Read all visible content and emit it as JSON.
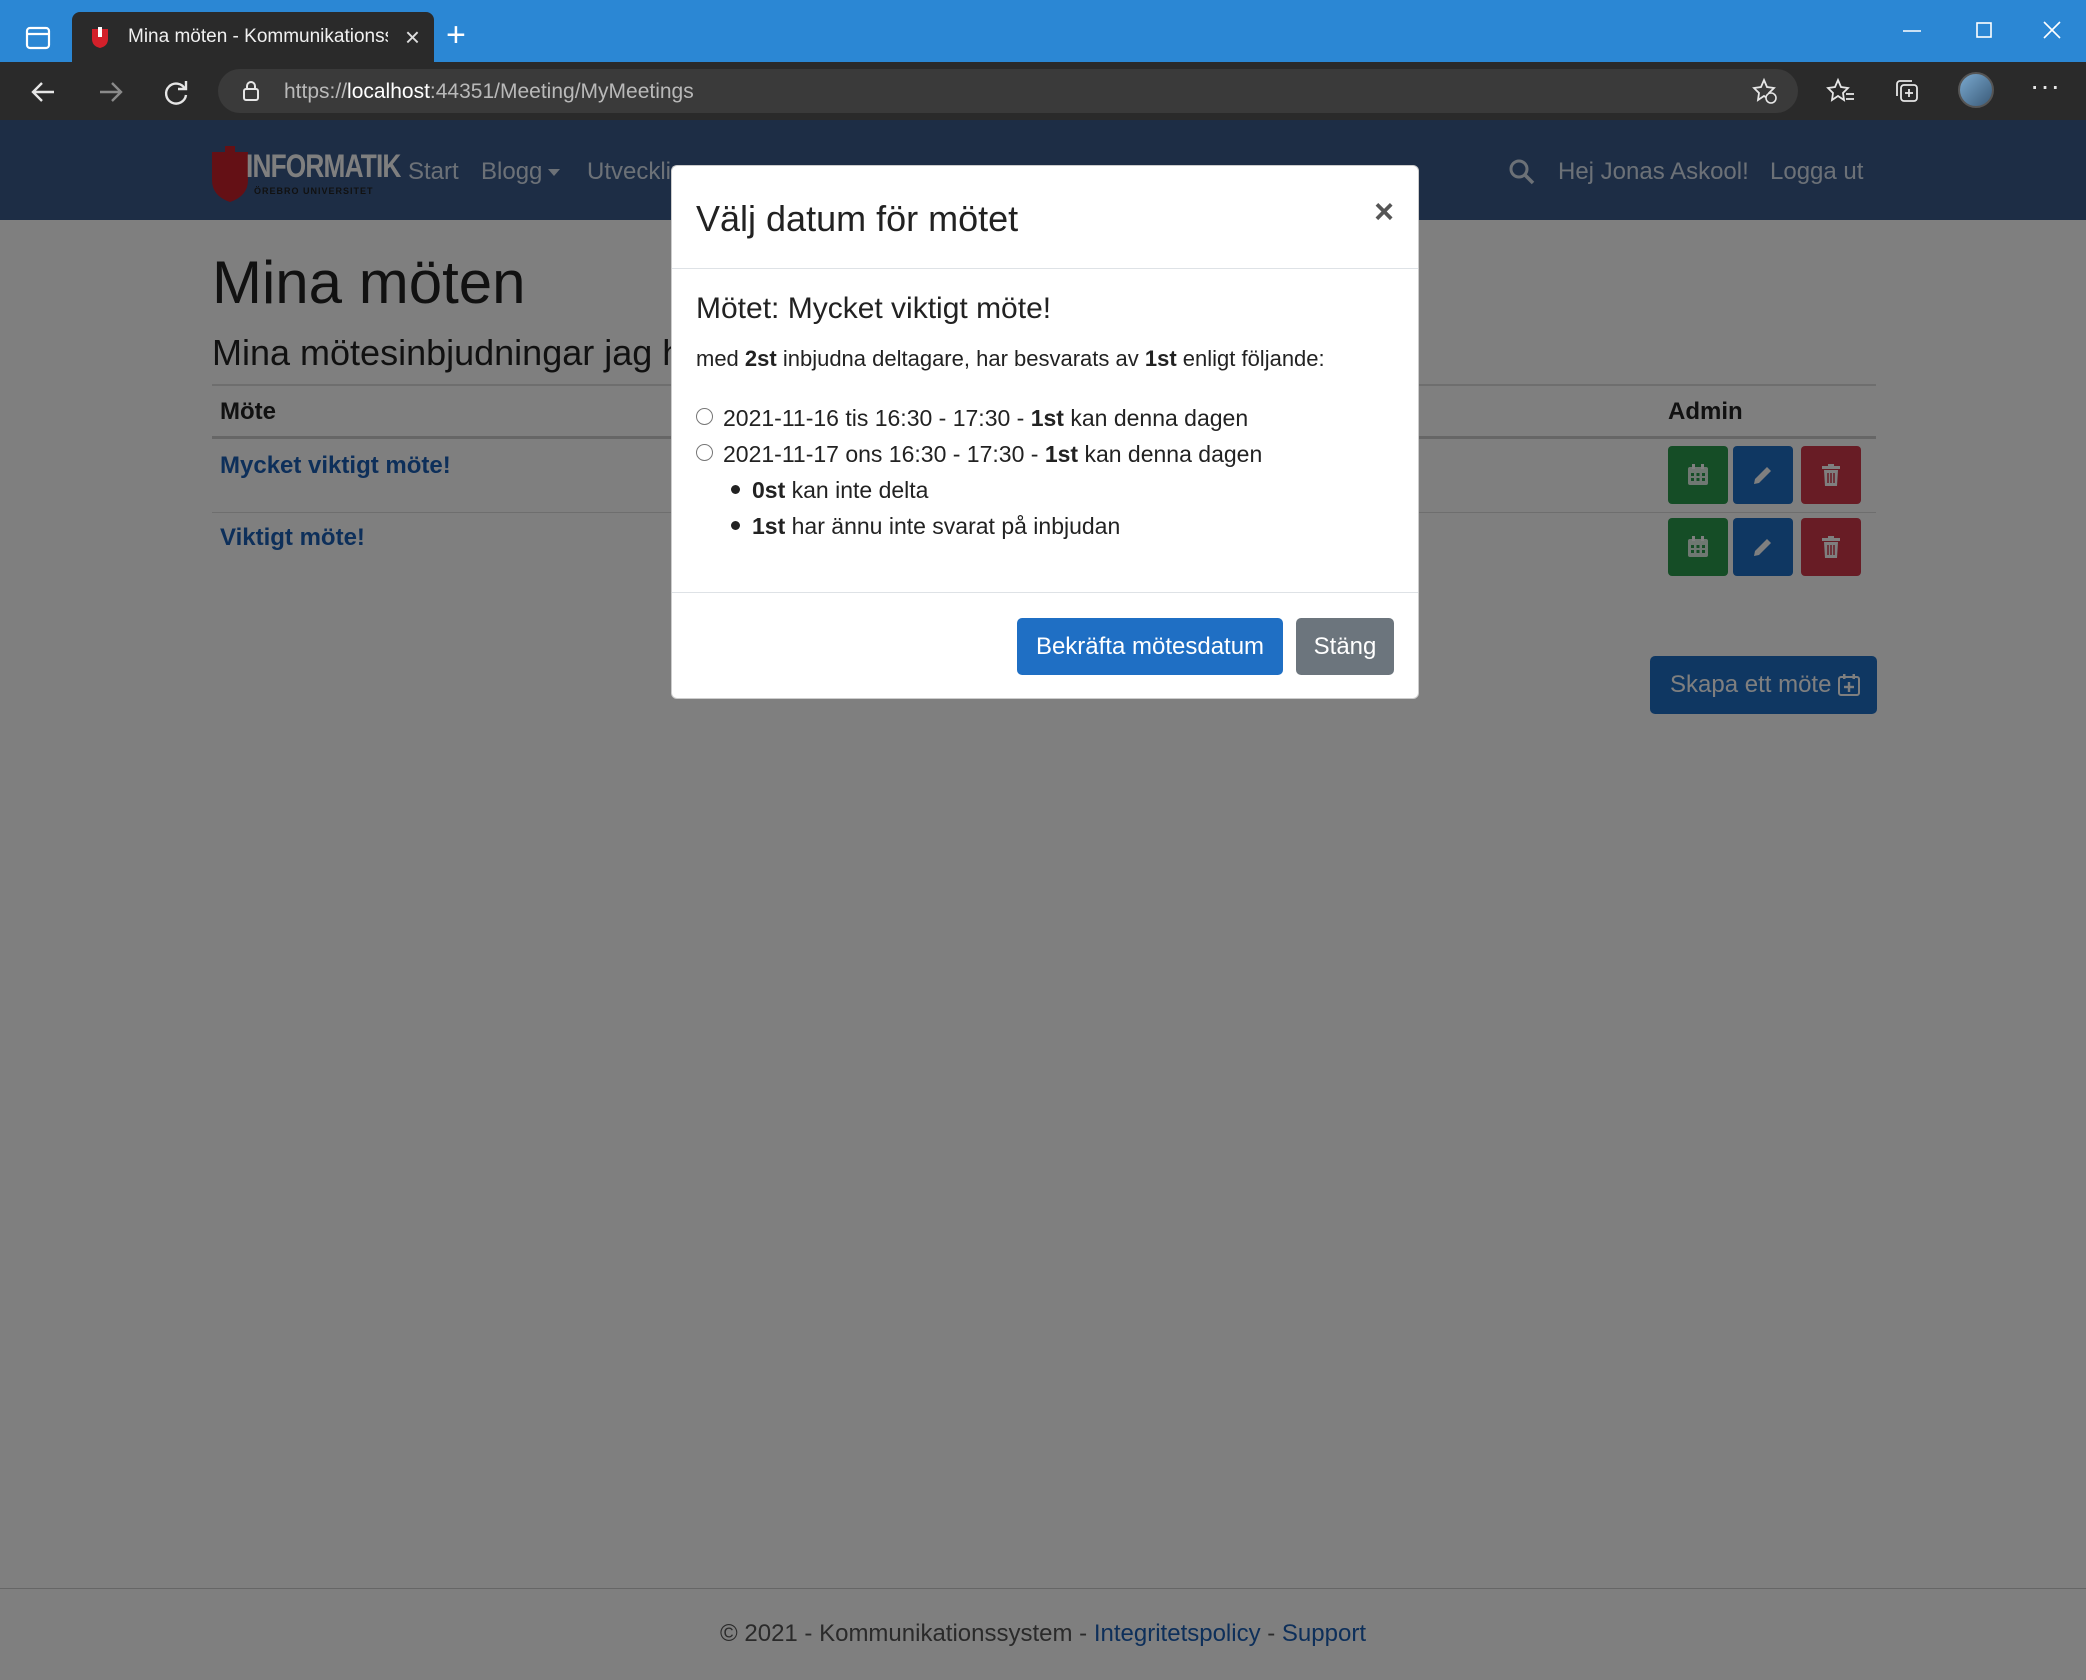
{
  "browser": {
    "tab_title": "Mina möten - Kommunikationssystem",
    "new_tab_symbol": "+",
    "url_scheme": "https://",
    "url_host": "localhost",
    "url_rest": ":44351/Meeting/MyMeetings",
    "more_label": "···"
  },
  "navbar": {
    "logo_text": "INFORMATIK",
    "logo_sub": "ÖREBRO UNIVERSITET",
    "links": [
      "Start",
      "Blogg",
      "Utveckling"
    ],
    "greeting": "Hej Jonas Askool!",
    "logout": "Logga ut"
  },
  "main": {
    "title": "Mina möten",
    "subtitle": "Mina mötesinbjudningar jag har skapat",
    "col_meeting": "Möte",
    "col_admin": "Admin",
    "meetings": [
      "Mycket viktigt möte!",
      "Viktigt möte!"
    ],
    "create_button": "Skapa ett möte"
  },
  "footer": {
    "text": "© 2021 - Kommunikationssystem - ",
    "privacy": "Integritetspolicy",
    "separator": " - ",
    "support": "Support"
  },
  "modal": {
    "title": "Välj datum för mötet",
    "close_symbol": "×",
    "meeting_title": "Mötet: Mycket viktigt möte!",
    "summary": {
      "prefix": "med ",
      "invited": "2st",
      "middle": " inbjudna deltagare, har besvarats av ",
      "answered": "1st",
      "suffix": " enligt följande:"
    },
    "options": [
      {
        "date": "2021-11-16 tis 16:30 - 17:30 - ",
        "count": "1st",
        "label": " kan denna dagen"
      },
      {
        "date": "2021-11-17 ons 16:30 - 17:30 - ",
        "count": "1st",
        "label": " kan denna dagen"
      }
    ],
    "bullets": [
      {
        "count": "0st",
        "label": " kan inte delta"
      },
      {
        "count": "1st",
        "label": " har ännu inte svarat på inbjudan"
      }
    ],
    "confirm_button": "Bekräfta mötesdatum",
    "close_button": "Stäng"
  }
}
